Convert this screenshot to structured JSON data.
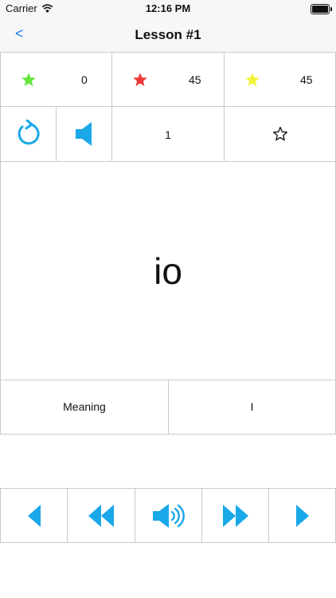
{
  "status_bar": {
    "carrier": "Carrier",
    "time": "12:16 PM"
  },
  "nav": {
    "back_label": "<",
    "title": "Lesson #1"
  },
  "scores": [
    {
      "icon": "green-star-icon",
      "color": "#66e63c",
      "value": "0"
    },
    {
      "icon": "red-star-icon",
      "color": "#ef3a3a",
      "value": "45"
    },
    {
      "icon": "yellow-star-icon",
      "color": "#f2f23a",
      "value": "45"
    }
  ],
  "controls": {
    "refresh_icon": "refresh-icon",
    "speaker_icon": "speaker-icon",
    "card_number": "1",
    "favorite_icon": "star-outline-icon"
  },
  "card": {
    "word": "io"
  },
  "meaning": {
    "label": "Meaning",
    "value": "I"
  },
  "colors": {
    "accent": "#1aa8e8",
    "link": "#1a7cf5"
  },
  "bottom_nav": [
    {
      "icon": "previous-icon"
    },
    {
      "icon": "rewind-icon"
    },
    {
      "icon": "speaker-loud-icon"
    },
    {
      "icon": "fast-forward-icon"
    },
    {
      "icon": "next-icon"
    }
  ]
}
